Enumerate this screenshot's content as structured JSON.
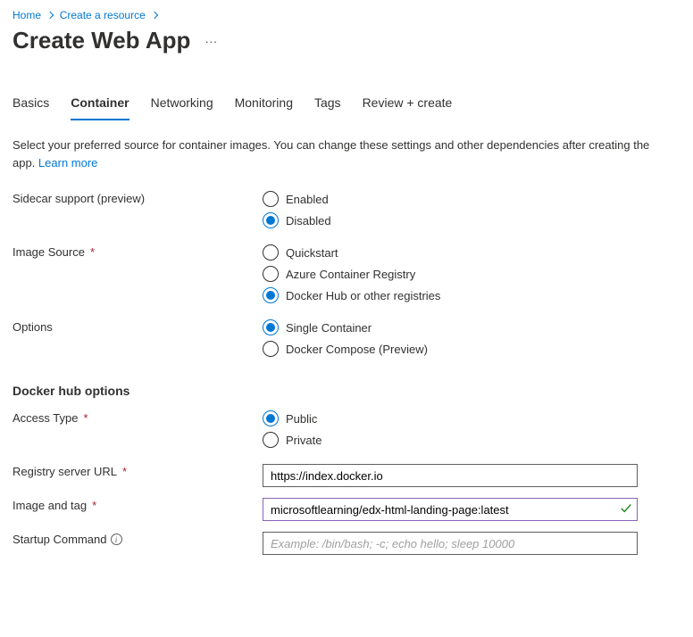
{
  "breadcrumb": {
    "items": [
      {
        "label": "Home"
      },
      {
        "label": "Create a resource"
      }
    ]
  },
  "title": "Create Web App",
  "tabs": [
    {
      "label": "Basics",
      "active": false
    },
    {
      "label": "Container",
      "active": true
    },
    {
      "label": "Networking",
      "active": false
    },
    {
      "label": "Monitoring",
      "active": false
    },
    {
      "label": "Tags",
      "active": false
    },
    {
      "label": "Review + create",
      "active": false
    }
  ],
  "intro": {
    "text": "Select your preferred source for container images. You can change these settings and other dependencies after creating the app.  ",
    "learn_more": "Learn more"
  },
  "fields": {
    "sidecar": {
      "label": "Sidecar support (preview)",
      "options": [
        {
          "label": "Enabled",
          "selected": false
        },
        {
          "label": "Disabled",
          "selected": true
        }
      ]
    },
    "image_source": {
      "label": "Image Source",
      "required": true,
      "options": [
        {
          "label": "Quickstart",
          "selected": false
        },
        {
          "label": "Azure Container Registry",
          "selected": false
        },
        {
          "label": "Docker Hub or other registries",
          "selected": true
        }
      ]
    },
    "options": {
      "label": "Options",
      "options": [
        {
          "label": "Single Container",
          "selected": true
        },
        {
          "label": "Docker Compose (Preview)",
          "selected": false
        }
      ]
    },
    "docker_section": "Docker hub options",
    "access_type": {
      "label": "Access Type",
      "required": true,
      "options": [
        {
          "label": "Public",
          "selected": true
        },
        {
          "label": "Private",
          "selected": false
        }
      ]
    },
    "registry_url": {
      "label": "Registry server URL",
      "required": true,
      "value": "https://index.docker.io"
    },
    "image_tag": {
      "label": "Image and tag",
      "required": true,
      "value": "microsoftlearning/edx-html-landing-page:latest",
      "valid": true
    },
    "startup_cmd": {
      "label": "Startup Command",
      "placeholder": "Example: /bin/bash; -c; echo hello; sleep 10000",
      "value": ""
    }
  }
}
